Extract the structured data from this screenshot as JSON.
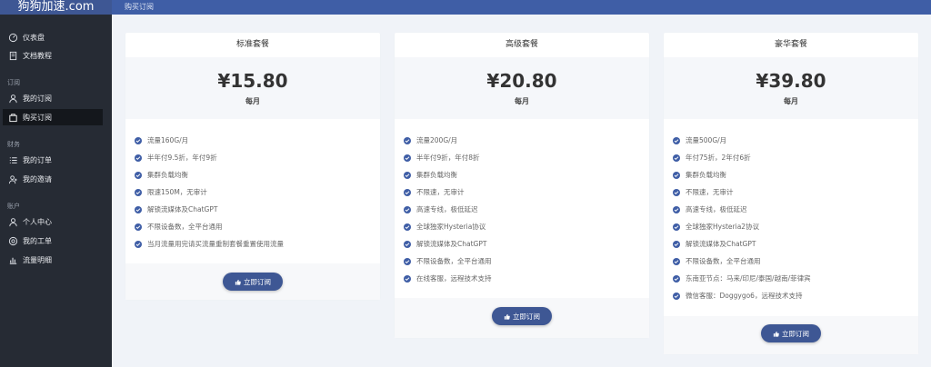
{
  "app": {
    "brand": "狗狗加速.com"
  },
  "header": {
    "breadcrumb": "购买订阅"
  },
  "sidebar": {
    "items": [
      {
        "label": "仪表盘",
        "icon": "dashboard-icon"
      },
      {
        "label": "文档教程",
        "icon": "book-icon"
      },
      {
        "label": "我的订阅",
        "icon": "user-icon"
      },
      {
        "label": "购买订阅",
        "icon": "bag-icon",
        "active": true
      },
      {
        "label": "我的订单",
        "icon": "list-icon"
      },
      {
        "label": "我的邀请",
        "icon": "invite-icon"
      },
      {
        "label": "个人中心",
        "icon": "profile-icon"
      },
      {
        "label": "我的工单",
        "icon": "ticket-icon"
      },
      {
        "label": "流量明细",
        "icon": "chart-icon"
      }
    ],
    "groups": [
      "订阅",
      "财务",
      "账户"
    ]
  },
  "plans": [
    {
      "name": "标准套餐",
      "price": "¥15.80",
      "period": "每月",
      "features": [
        "流量160G/月",
        "半年付9.5折，年付9折",
        "集群负载均衡",
        "限速150M，无审计",
        "解锁流媒体及ChatGPT",
        "不限设备数，全平台通用",
        "当月流量用完请买流量重制套餐重置使用流量"
      ],
      "button": "立即订阅"
    },
    {
      "name": "高级套餐",
      "price": "¥20.80",
      "period": "每月",
      "features": [
        "流量200G/月",
        "半年付9折，年付8折",
        "集群负载均衡",
        "不限速，无审计",
        "高速专线，极低延迟",
        "全球独家Hysteria协议",
        "解锁流媒体及ChatGPT",
        "不限设备数，全平台通用",
        "在线客服，远程技术支持"
      ],
      "button": "立即订阅"
    },
    {
      "name": "豪华套餐",
      "price": "¥39.80",
      "period": "每月",
      "features": [
        "流量500G/月",
        "年付75折，2年付6折",
        "集群负载均衡",
        "不限速，无审计",
        "高速专线，极低延迟",
        "全球独家Hysteria2协议",
        "解锁流媒体及ChatGPT",
        "不限设备数，全平台通用",
        "东南亚节点：马来/印尼/泰国/越南/菲律宾",
        "微信客服：Doggygo6，远程技术支持"
      ],
      "button": "立即订阅"
    }
  ],
  "colors": {
    "accent": "#3e5794",
    "sidebar": "#262b34",
    "background": "#f0f3f8"
  }
}
